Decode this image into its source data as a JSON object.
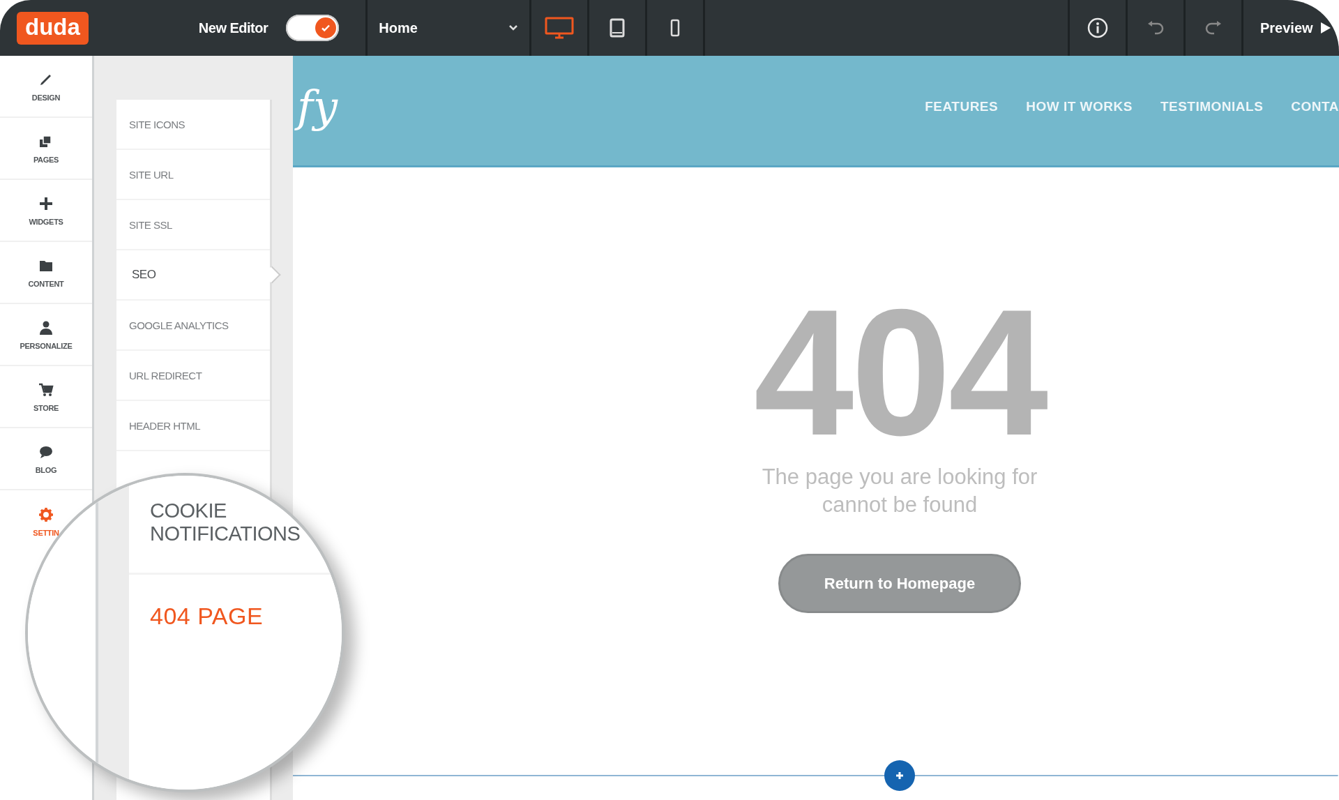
{
  "topbar": {
    "logo": "duda",
    "editor_toggle": {
      "label": "New Editor",
      "on": true
    },
    "page_select": {
      "value": "Home"
    },
    "devices": [
      {
        "kind": "desktop",
        "selected": true
      },
      {
        "kind": "tablet",
        "selected": false
      },
      {
        "kind": "phone",
        "selected": false
      }
    ],
    "preview": {
      "label": "Preview"
    }
  },
  "rail": [
    {
      "label": "DESIGN",
      "selected": false
    },
    {
      "label": "PAGES",
      "selected": false
    },
    {
      "label": "WIDGETS",
      "selected": false
    },
    {
      "label": "CONTENT",
      "selected": false
    },
    {
      "label": "PERSONALIZE",
      "selected": false
    },
    {
      "label": "STORE",
      "selected": false
    },
    {
      "label": "BLOG",
      "selected": false
    },
    {
      "label": "SETTIN",
      "selected": true
    }
  ],
  "settings_menu": [
    {
      "label": "SITE ICONS",
      "selected": false
    },
    {
      "label": "SITE URL",
      "selected": false
    },
    {
      "label": "SITE SSL",
      "selected": false
    },
    {
      "label": "SEO",
      "selected": true
    },
    {
      "label": "GOOGLE ANALYTICS",
      "selected": false
    },
    {
      "label": "URL REDIRECT",
      "selected": false
    },
    {
      "label": "HEADER HTML",
      "selected": false
    }
  ],
  "lens_menu": [
    {
      "label": "COOKIE NOTIFICATIONS",
      "selected": false
    },
    {
      "label": "404 PAGE",
      "selected": true
    }
  ],
  "site": {
    "logo": "fy",
    "nav": [
      "FEATURES",
      "HOW IT WORKS",
      "TESTIMONIALS",
      "CONTA"
    ],
    "error_code": "404",
    "message": "The page you are looking for cannot be found",
    "button": "Return to Homepage"
  }
}
